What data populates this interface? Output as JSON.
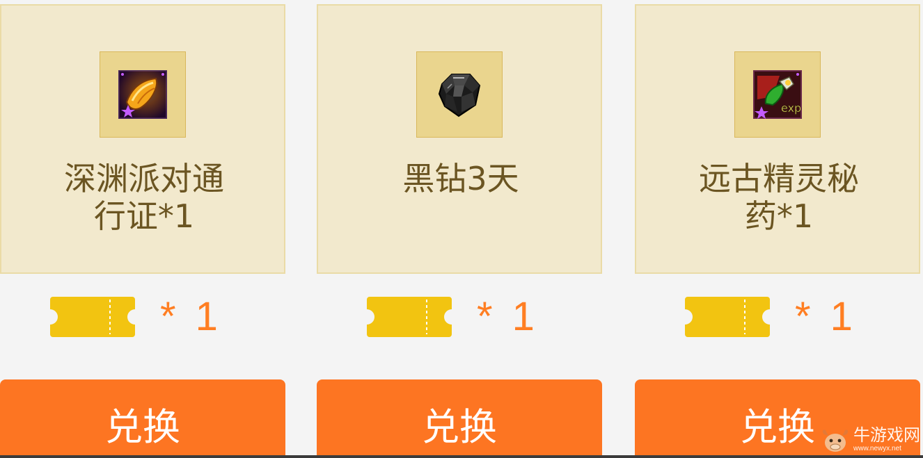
{
  "items": [
    {
      "name_line1": "深渊派对通",
      "name_line2": "行证*1",
      "icon": "abyss-pass-icon",
      "cost_text": "* 1",
      "button_label": "兑换"
    },
    {
      "name_line1": "黑钻3天",
      "name_line2": "",
      "icon": "black-diamond-icon",
      "cost_text": "* 1",
      "button_label": "兑换"
    },
    {
      "name_line1": "远古精灵秘",
      "name_line2": "药*1",
      "icon": "ancient-elf-potion-icon",
      "cost_text": "* 1",
      "button_label": "兑换"
    }
  ],
  "ticket_icon": "ticket-icon",
  "colors": {
    "accent": "#fd7522",
    "cost_text": "#ff7e22",
    "card_bg": "#f2e9cd",
    "card_border": "#eadba6",
    "name_text": "#6b5522",
    "ticket": "#f2c411"
  },
  "watermark": {
    "main": "牛游戏网",
    "sub": "www.newyx.net"
  }
}
